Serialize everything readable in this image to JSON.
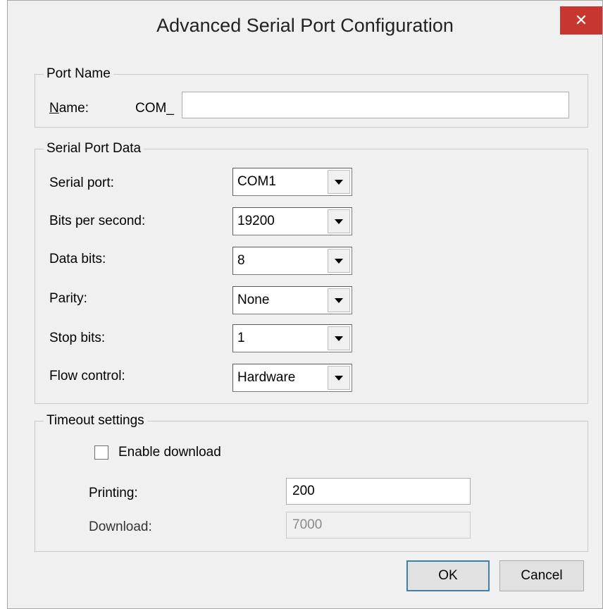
{
  "window": {
    "title": "Advanced Serial Port Configuration",
    "close_glyph": "✕"
  },
  "port_name": {
    "legend": "Port Name",
    "name_label_mnemonic": "N",
    "name_label_rest": "ame:",
    "prefix": "COM_",
    "name_value": ""
  },
  "serial_port_data": {
    "legend": "Serial Port Data",
    "rows": [
      {
        "label": "Serial port:",
        "value": "COM1"
      },
      {
        "label": "Bits per second:",
        "value": "19200"
      },
      {
        "label": "Data bits:",
        "value": "8"
      },
      {
        "label": "Parity:",
        "value": "None"
      },
      {
        "label": "Stop bits:",
        "value": "1"
      },
      {
        "label": "Flow control:",
        "value": "Hardware"
      }
    ]
  },
  "timeout_settings": {
    "legend": "Timeout settings",
    "enable_download_label": "Enable download",
    "enable_download_checked": false,
    "printing_label": "Printing:",
    "printing_value": "200",
    "download_label": "Download:",
    "download_value": "7000"
  },
  "buttons": {
    "ok": "OK",
    "cancel": "Cancel"
  }
}
